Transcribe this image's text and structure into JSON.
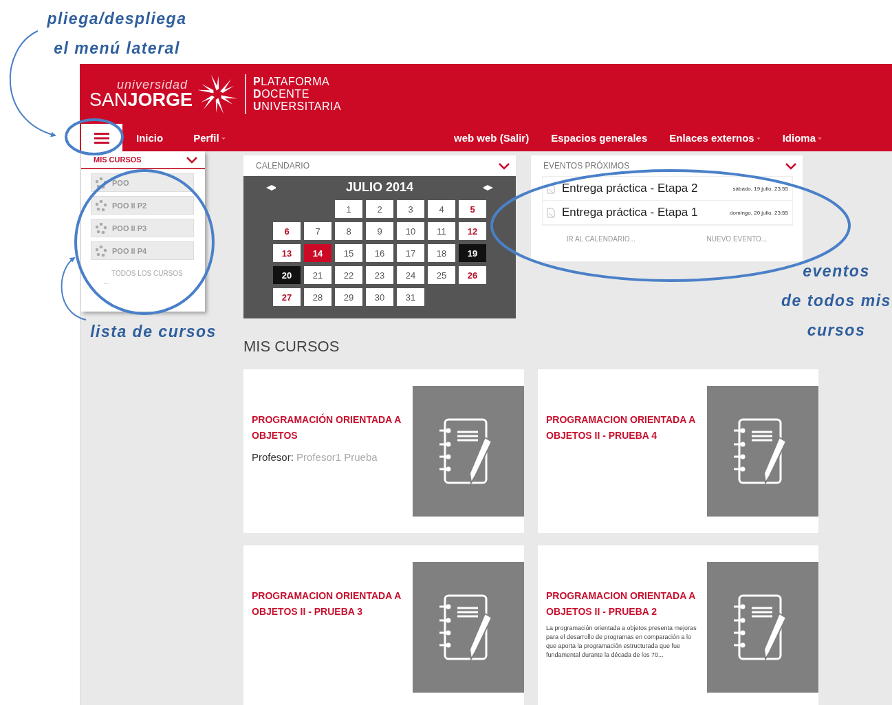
{
  "header": {
    "logo": {
      "tagline": "universidad",
      "name": "SAN**JORGE**",
      "platform_lines": [
        "**P**LATAFORMA",
        "**D**OCENTE",
        "**U**NIVERSITARIA"
      ]
    },
    "nav_left": [
      {
        "label": "Inicio",
        "has_menu": false
      },
      {
        "label": "Perfil",
        "has_menu": true
      }
    ],
    "nav_right": [
      {
        "label": "web web (Salir)",
        "has_menu": false
      },
      {
        "label": "Espacios generales",
        "has_menu": false
      },
      {
        "label": "Enlaces externos",
        "has_menu": true
      },
      {
        "label": "Idioma",
        "has_menu": true
      }
    ]
  },
  "sidebar": {
    "title": "MIS CURSOS",
    "courses": [
      "POO",
      "POO II P2",
      "POO II P3",
      "POO II P4"
    ],
    "all_link": "TODOS LOS CURSOS",
    "more": "..."
  },
  "calendar": {
    "title": "CALENDARIO",
    "month": "JULIO 2014",
    "weeks": [
      [
        {
          "kind": "empty"
        },
        {
          "kind": "empty"
        },
        {
          "day": "1",
          "kind": "plain"
        },
        {
          "day": "2",
          "kind": "plain"
        },
        {
          "day": "3",
          "kind": "plain"
        },
        {
          "day": "4",
          "kind": "plain"
        },
        {
          "day": "5",
          "kind": "weekend"
        }
      ],
      [
        {
          "day": "6",
          "kind": "weekend"
        },
        {
          "day": "7",
          "kind": "plain"
        },
        {
          "day": "8",
          "kind": "plain"
        },
        {
          "day": "9",
          "kind": "plain"
        },
        {
          "day": "10",
          "kind": "plain"
        },
        {
          "day": "11",
          "kind": "plain"
        },
        {
          "day": "12",
          "kind": "weekend"
        }
      ],
      [
        {
          "day": "13",
          "kind": "weekend"
        },
        {
          "day": "14",
          "kind": "today"
        },
        {
          "day": "15",
          "kind": "plain"
        },
        {
          "day": "16",
          "kind": "plain"
        },
        {
          "day": "17",
          "kind": "plain"
        },
        {
          "day": "18",
          "kind": "plain"
        },
        {
          "day": "19",
          "kind": "event"
        }
      ],
      [
        {
          "day": "20",
          "kind": "event"
        },
        {
          "day": "21",
          "kind": "plain"
        },
        {
          "day": "22",
          "kind": "plain"
        },
        {
          "day": "23",
          "kind": "plain"
        },
        {
          "day": "24",
          "kind": "plain"
        },
        {
          "day": "25",
          "kind": "plain"
        },
        {
          "day": "26",
          "kind": "weekend"
        }
      ],
      [
        {
          "day": "27",
          "kind": "weekend"
        },
        {
          "day": "28",
          "kind": "plain"
        },
        {
          "day": "29",
          "kind": "plain"
        },
        {
          "day": "30",
          "kind": "plain"
        },
        {
          "day": "31",
          "kind": "plain"
        }
      ]
    ]
  },
  "events": {
    "title": "EVENTOS PRÓXIMOS",
    "items": [
      {
        "title": "Entrega práctica - Etapa 2",
        "date": "sábado, 19 julio, 23:55"
      },
      {
        "title": "Entrega práctica - Etapa 1",
        "date": "domingo, 20 julio, 23:55"
      }
    ],
    "links": [
      "IR AL CALENDARIO...",
      "NUEVO EVENTO..."
    ]
  },
  "courses": {
    "heading": "MIS CURSOS",
    "cards": [
      {
        "title": "PROGRAMACIÓN ORIENTADA A OBJETOS",
        "teacher_label": "Profesor:",
        "teacher": "Profesor1 Prueba"
      },
      {
        "title": "PROGRAMACION ORIENTADA A OBJETOS II - PRUEBA 4"
      },
      {
        "title": "PROGRAMACION ORIENTADA A OBJETOS II - PRUEBA 3"
      },
      {
        "title": "PROGRAMACION ORIENTADA A OBJETOS II - PRUEBA 2",
        "description": "La programación orientada a objetos presenta mejoras para el desarrollo de programas en comparación a lo que aporta la programación estructurada que fue fundamental durante la década de los 70..."
      }
    ]
  },
  "annotations": [
    {
      "lines": [
        "pliega/despliega",
        "el menú lateral"
      ]
    },
    {
      "lines": [
        "lista de cursos"
      ]
    },
    {
      "lines": [
        "eventos",
        "de todos mis",
        "cursos"
      ]
    }
  ]
}
